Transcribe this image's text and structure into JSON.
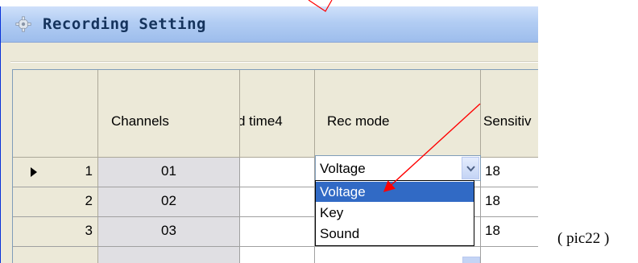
{
  "window": {
    "title": "Recording Setting",
    "title_icon": "gear-icon"
  },
  "table": {
    "columns": [
      "Channels",
      "d time4",
      "Rec mode",
      "Sensitiv"
    ],
    "rows": [
      {
        "num": "1",
        "channel": "01",
        "sensitivity": "18",
        "current": true
      },
      {
        "num": "2",
        "channel": "02",
        "sensitivity": "18",
        "current": false
      },
      {
        "num": "3",
        "channel": "03",
        "sensitivity": "18",
        "current": false
      }
    ]
  },
  "rec_mode": {
    "selected": "Voltage",
    "options": [
      "Voltage",
      "Key",
      "Sound"
    ],
    "highlighted": "Voltage"
  },
  "caption": "( pic22 )",
  "colors": {
    "selection": "#316ac5",
    "annotation": "#ff0000"
  }
}
